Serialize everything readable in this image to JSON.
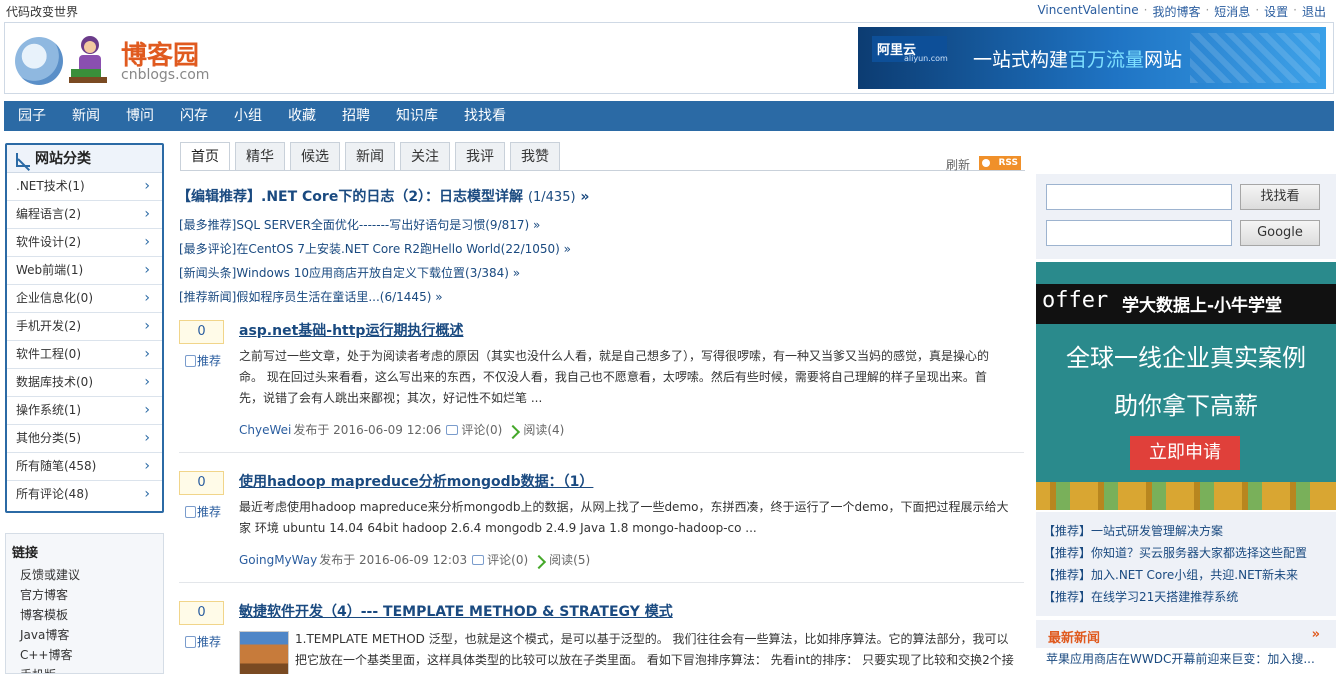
{
  "top": {
    "slogan": "代码改变世界",
    "user_links": [
      "VincentValentine",
      "我的博客",
      "短消息",
      "设置",
      "退出"
    ]
  },
  "header": {
    "logo_cn": "博客园",
    "logo_en": "cnblogs.com",
    "ad": {
      "brand": "阿里云",
      "brand_sub": "aliyun.com",
      "text_pre": "一站式构建",
      "text_highlight": "百万流量",
      "text_post": "网站"
    }
  },
  "nav": [
    "园子",
    "新闻",
    "博问",
    "闪存",
    "小组",
    "收藏",
    "招聘",
    "知识库",
    "找找看"
  ],
  "categories": {
    "title": "网站分类",
    "items": [
      ".NET技术(1)",
      "编程语言(2)",
      "软件设计(2)",
      "Web前端(1)",
      "企业信息化(0)",
      "手机开发(2)",
      "软件工程(0)",
      "数据库技术(0)",
      "操作系统(1)",
      "其他分类(5)",
      "所有随笔(458)",
      "所有评论(48)"
    ],
    "chevron": "›"
  },
  "links": {
    "title": "链接",
    "items": [
      "反馈或建议",
      "官方博客",
      "博客模板",
      "Java博客",
      "C++博客",
      "手机版"
    ]
  },
  "tabs": [
    "首页",
    "精华",
    "候选",
    "新闻",
    "关注",
    "我评",
    "我赞"
  ],
  "refresh_label": "刷新",
  "rss_label": "RSS",
  "editor_rec": {
    "text": "【编辑推荐】.NET Core下的日志（2）：日志模型详解",
    "count": "(1/435)",
    "arrow": "»"
  },
  "rec_lines": [
    "[最多推荐]SQL SERVER全面优化-------写出好语句是习惯(9/817) »",
    "[最多评论]在CentOS 7上安装.NET Core R2跑Hello World(22/1050) »",
    "[新闻头条]Windows 10应用商店开放自定义下载位置(3/384) »",
    "[推荐新闻]假如程序员生活在童话里...(6/1445) »"
  ],
  "posts": [
    {
      "votes": "0",
      "vote_label": "推荐",
      "title": "asp.net基础-http运行期执行概述",
      "summary": "之前写过一些文章，处于为阅读者考虑的原因（其实也没什么人看，就是自己想多了），写得很啰嗦，有一种又当爹又当妈的感觉，真是操心的命。 现在回过头来看看，这么写出来的东西，不仅没人看，我自己也不愿意看，太啰嗦。然后有些时候，需要将自己理解的样子呈现出来。首先，说错了会有人跳出来鄙视；其次，好记性不如烂笔 ...",
      "author": "ChyeWei",
      "published": "发布于 2016-06-09 12:06",
      "comments": "评论(0)",
      "reads": "阅读(4)"
    },
    {
      "votes": "0",
      "vote_label": "推荐",
      "title": "使用hadoop mapreduce分析mongodb数据：（1）",
      "summary": "最近考虑使用hadoop mapreduce来分析mongodb上的数据，从网上找了一些demo，东拼西凑，终于运行了一个demo，下面把过程展示给大家 环境 ubuntu 14.04 64bit hadoop 2.6.4 mongodb 2.4.9 Java 1.8 mongo-hadoop-co ...",
      "author": "GoingMyWay",
      "published": "发布于 2016-06-09 12:03",
      "comments": "评论(0)",
      "reads": "阅读(5)"
    },
    {
      "votes": "0",
      "vote_label": "推荐",
      "title": "敏捷软件开发（4）--- TEMPLATE METHOD & STRATEGY 模式",
      "summary": "1.TEMPLATE METHOD 泛型，也就是这个模式，是可以基于泛型的。 我们往往会有一些算法，比如排序算法。它的算法部分，我可以把它放在一个基类里面，这样具体类型的比较可以放在子类里面。 看如下冒泡排序算法： 先看int的排序： 只要实现了比较和交换2个接"
    }
  ],
  "search": {
    "zzk_button": "找找看",
    "google_button": "Google"
  },
  "right_ad": {
    "offer": "offer",
    "offer_tail": "学大数据上-小牛学堂",
    "line1": "全球一线企业真实案例",
    "line2": "助你拿下高薪",
    "cta": "立即申请"
  },
  "promos": [
    "【推荐】一站式研发管理解决方案",
    "【推荐】你知道？买云服务器大家都选择这些配置",
    "【推荐】加入.NET Core小组，共迎.NET新未来",
    "【推荐】在线学习21天搭建推荐系统"
  ],
  "latest_news": {
    "title": "最新新闻",
    "more": "»",
    "first_item": "苹果应用商店在WWDC开幕前迎来巨变：加入搜..."
  }
}
